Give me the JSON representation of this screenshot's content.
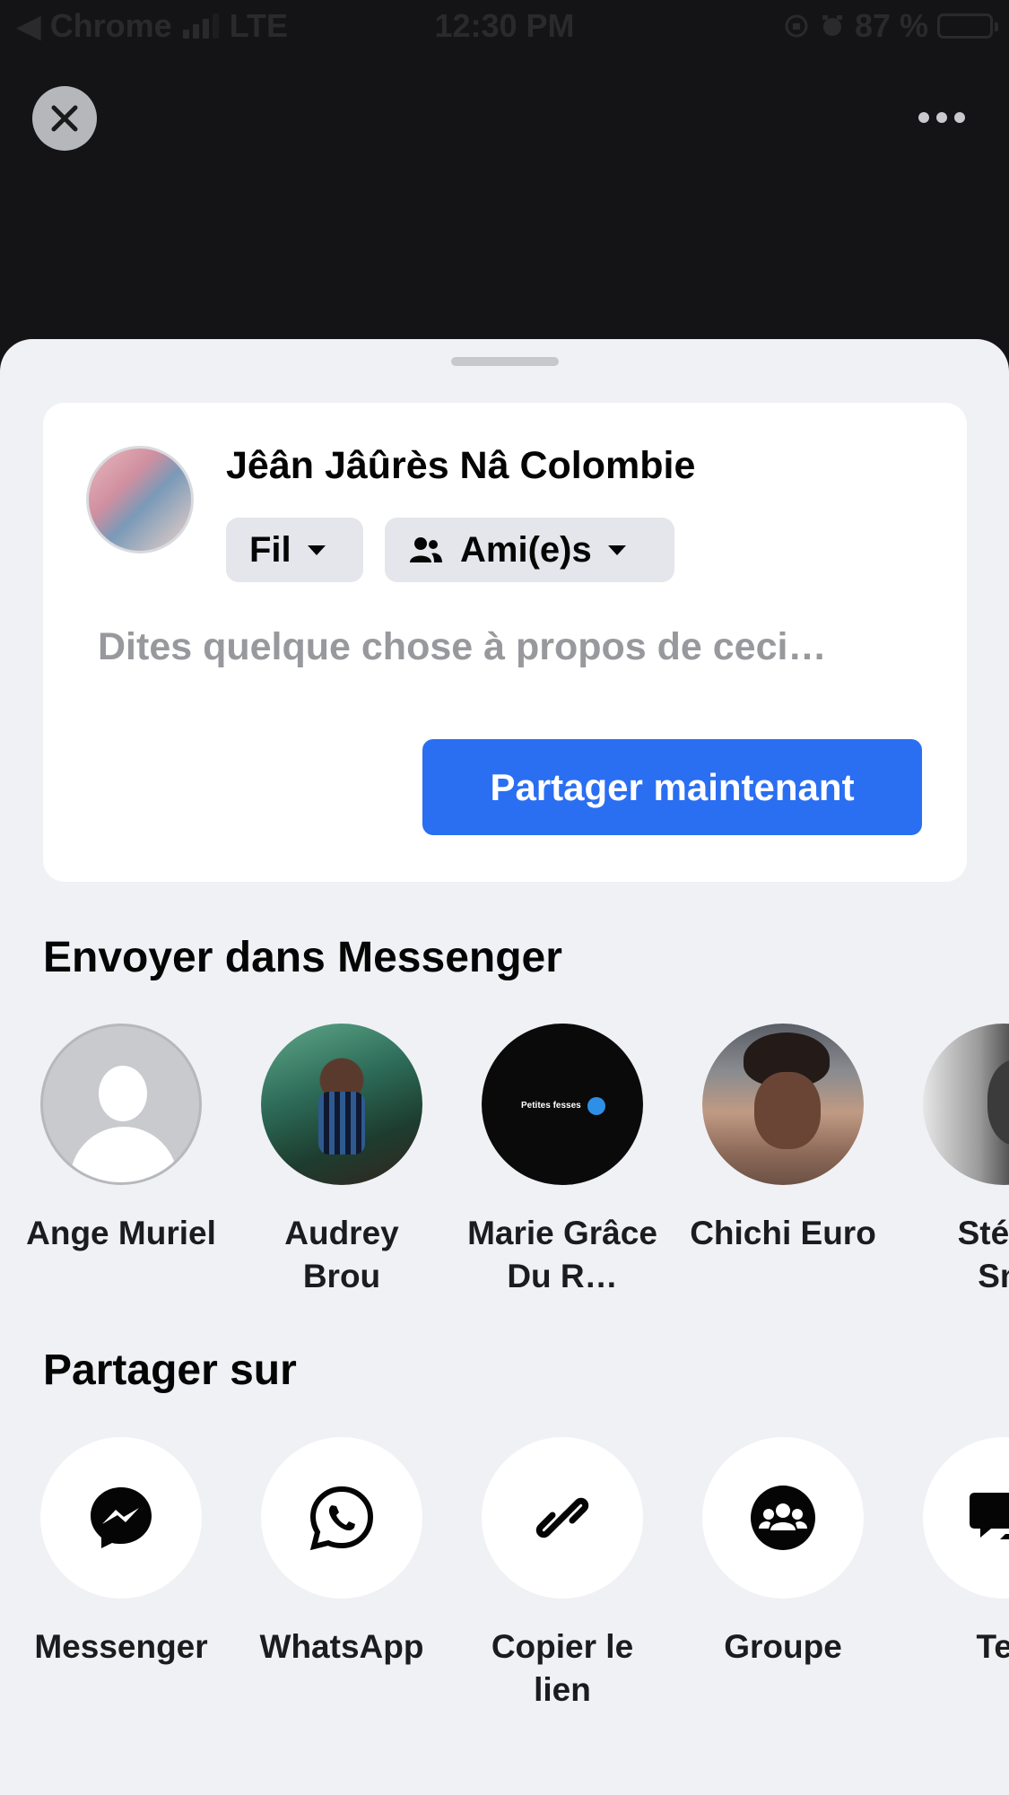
{
  "status_bar": {
    "back_app": "◀ Chrome",
    "network": "LTE",
    "time": "12:30 PM",
    "battery": "87 %",
    "battery_level": 0.87
  },
  "composer": {
    "user_name": "Jêân Jâûrès Nâ Colombie",
    "destination": "Fil",
    "audience": "Ami(e)s",
    "placeholder": "Dites quelque chose à propos de ceci…",
    "share_now": "Partager maintenant"
  },
  "messenger_section": {
    "title": "Envoyer dans Messenger",
    "contacts": [
      {
        "name": "Ange Muriel",
        "avatar": "default-avatar"
      },
      {
        "name": "Audrey\nBrou",
        "avatar": "photo"
      },
      {
        "name": "Marie Grâce\nDu R…",
        "avatar": "photo"
      },
      {
        "name": "Chichi Euro",
        "avatar": "photo"
      },
      {
        "name": "Stéph\nSm",
        "avatar": "photo"
      }
    ]
  },
  "share_section": {
    "title": "Partager sur",
    "apps": [
      {
        "label": "Messenger",
        "icon": "messenger-icon"
      },
      {
        "label": "WhatsApp",
        "icon": "whatsapp-icon"
      },
      {
        "label": "Copier le\nlien",
        "icon": "link-icon"
      },
      {
        "label": "Groupe",
        "icon": "group-icon"
      },
      {
        "label": "Tex",
        "icon": "text-message-icon"
      }
    ]
  },
  "colors": {
    "backdrop": "#141416",
    "sheet": "#f0f1f5",
    "primary_button": "#2a6ef2",
    "pill": "#e4e6eb"
  }
}
